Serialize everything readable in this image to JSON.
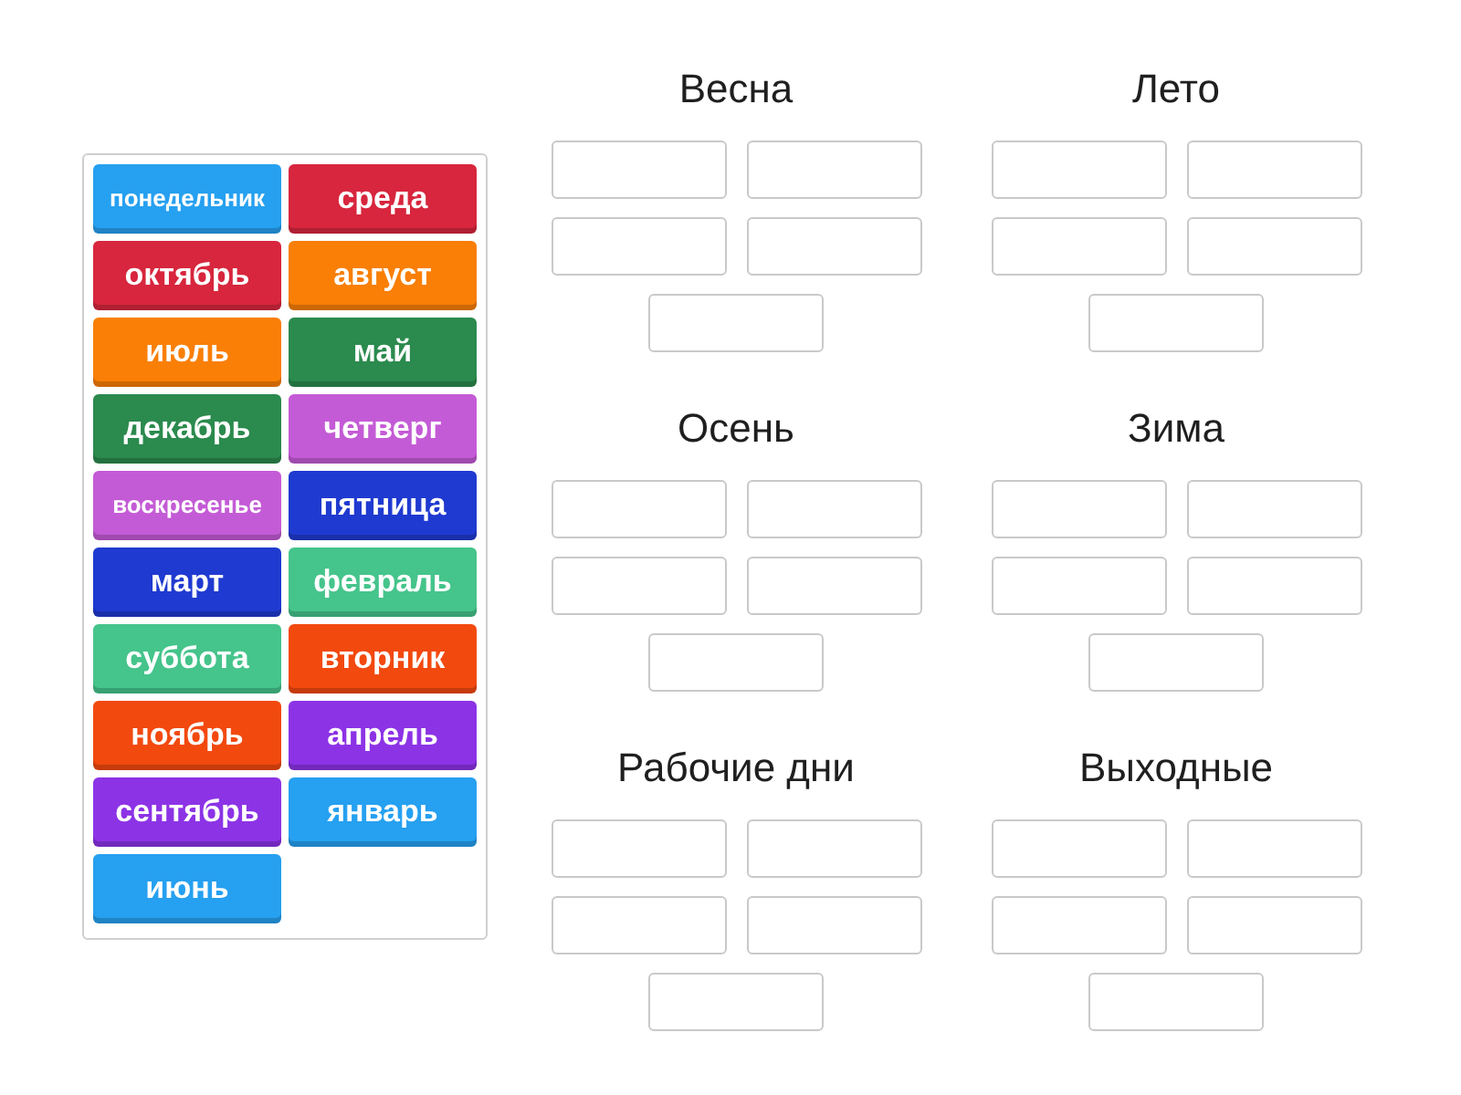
{
  "tiles": [
    {
      "label": "понедельник",
      "color": "#26a0f0"
    },
    {
      "label": "среда",
      "color": "#d7263d"
    },
    {
      "label": "октябрь",
      "color": "#d7263d"
    },
    {
      "label": "август",
      "color": "#f97f06"
    },
    {
      "label": "июль",
      "color": "#f97f06"
    },
    {
      "label": "май",
      "color": "#2b8a4e"
    },
    {
      "label": "декабрь",
      "color": "#2b8a4e"
    },
    {
      "label": "четверг",
      "color": "#c45bd6"
    },
    {
      "label": "воскресенье",
      "color": "#c45bd6"
    },
    {
      "label": "пятница",
      "color": "#1f3ad0"
    },
    {
      "label": "март",
      "color": "#1f3ad0"
    },
    {
      "label": "февраль",
      "color": "#45c48b"
    },
    {
      "label": "суббота",
      "color": "#45c48b"
    },
    {
      "label": "вторник",
      "color": "#f2490f"
    },
    {
      "label": "ноябрь",
      "color": "#f2490f"
    },
    {
      "label": "апрель",
      "color": "#8c33e6"
    },
    {
      "label": "сентябрь",
      "color": "#8c33e6"
    },
    {
      "label": "январь",
      "color": "#26a0f0"
    },
    {
      "label": "июнь",
      "color": "#26a0f0"
    }
  ],
  "groups": [
    {
      "title": "Весна"
    },
    {
      "title": "Лето"
    },
    {
      "title": "Осень"
    },
    {
      "title": "Зима"
    },
    {
      "title": "Рабочие дни"
    },
    {
      "title": "Выходные"
    }
  ]
}
